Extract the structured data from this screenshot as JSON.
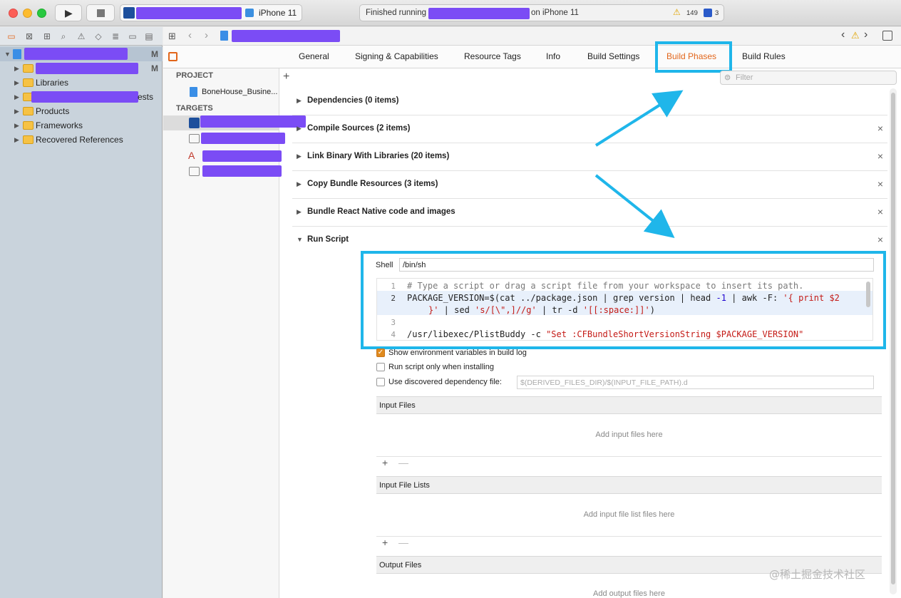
{
  "toolbar": {
    "device": "iPhone 11",
    "activity_status": "Finished running",
    "activity_device": "on iPhone 11",
    "warning_count": "149",
    "issue_count": "3"
  },
  "navigator": {
    "root_badge": "M",
    "items": [
      {
        "label": "",
        "badge": "M"
      },
      {
        "label": "Libraries"
      },
      {
        "label": "ests"
      },
      {
        "label": "Products"
      },
      {
        "label": "Frameworks"
      },
      {
        "label": "Recovered References"
      }
    ]
  },
  "editor": {
    "tabs": [
      "General",
      "Signing & Capabilities",
      "Resource Tags",
      "Info",
      "Build Settings",
      "Build Phases",
      "Build Rules"
    ],
    "active_tab": "Build Phases",
    "project_header": "PROJECT",
    "project_name": "BoneHouse_Busine...",
    "targets_header": "TARGETS",
    "filter_placeholder": "Filter",
    "add_symbol": "+",
    "phases": [
      {
        "title": "Dependencies (0 items)",
        "removable": false
      },
      {
        "title": "Compile Sources (2 items)",
        "removable": true
      },
      {
        "title": "Link Binary With Libraries (20 items)",
        "removable": true
      },
      {
        "title": "Copy Bundle Resources (3 items)",
        "removable": true
      },
      {
        "title": "Bundle React Native code and images",
        "removable": true
      },
      {
        "title": "Run Script",
        "removable": true,
        "expanded": true
      }
    ],
    "run_script": {
      "shell_label": "Shell",
      "shell_value": "/bin/sh",
      "lines": [
        "1",
        "2",
        "3",
        "4"
      ],
      "code_line1": "# Type a script or drag a script file from your workspace to insert its path.",
      "code_line2a": "PACKAGE_VERSION=$(cat ../package.json | grep version | head ",
      "code_line2num": "-1",
      "code_line2b": " | awk -F: ",
      "code_line2str": "'{ print $2",
      "code_line2c_str": "}'",
      "code_line2c": " | sed ",
      "code_line2c_str2": "'s/[\\\",]//g'",
      "code_line2c2": " | tr -d ",
      "code_line2c_str3": "'[[:space:]]'",
      "code_line2c3": ")",
      "code_line4a": "/usr/libexec/PlistBuddy -c ",
      "code_line4str": "\"Set :CFBundleShortVersionString $PACKAGE_VERSION\"",
      "opt_env": "Show environment variables in build log",
      "opt_install": "Run script only when installing",
      "opt_dep": "Use discovered dependency file:",
      "dep_placeholder": "$(DERIVED_FILES_DIR)/$(INPUT_FILE_PATH).d",
      "env_checked": true,
      "input_files": "Input Files",
      "input_files_empty": "Add input files here",
      "input_lists": "Input File Lists",
      "input_lists_empty": "Add input file list files here",
      "output_files": "Output Files",
      "output_files_empty": "Add output files here",
      "plus": "+",
      "minus": "—"
    }
  },
  "watermark": "@稀土掘金技术社区",
  "colors": {
    "accent": "#e2661b",
    "highlight": "#1fb6ea",
    "redaction": "#7b4cf5"
  }
}
